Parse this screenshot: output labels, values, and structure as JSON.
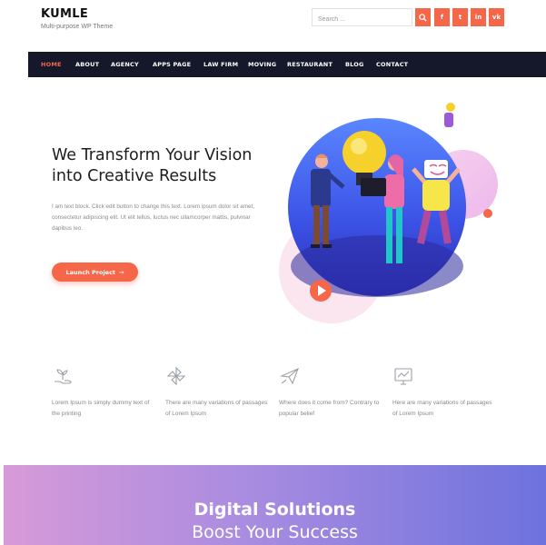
{
  "site": {
    "logo": "KUMLE",
    "tagline": "Multi-purpose WP Theme",
    "search_placeholder": "Search ...",
    "social": [
      "f",
      "t",
      "in",
      "vk"
    ],
    "accent_color": "#f6674a",
    "nav_bg": "#15172a"
  },
  "nav": {
    "items": [
      "HOME",
      "ABOUT",
      "AGENCY",
      "APPS PAGE",
      "LAW FIRM",
      "MOVING",
      "RESTAURANT",
      "BLOG",
      "CONTACT"
    ],
    "active": "HOME"
  },
  "hero": {
    "title_line1": "We Transform Your Vision",
    "title_line2": "into Creative Results",
    "text": "I am text block. Click edit button to change this text. Lorem ipsum dolor sit amet, consectetur adipiscing elit. Ut elit tellus, luctus nec ullamcorper mattis, pulvinar dapibus leo.",
    "cta_label": "Launch Project",
    "cta_arrow": "→"
  },
  "features": [
    {
      "icon": "plant-hand-icon",
      "text": "Lorem Ipsum is simply dummy text of the printing"
    },
    {
      "icon": "pinwheel-icon",
      "text": "There are many variations of passages of Lorem Ipsum"
    },
    {
      "icon": "paper-plane-icon",
      "text": "Where does it come from? Contrary to popular belief"
    },
    {
      "icon": "monitor-chart-icon",
      "text": "Here are many variations of passages of Lorem Ipsum"
    }
  ],
  "banner": {
    "title": "Digital Solutions",
    "subtitle": "Boost Your Success"
  }
}
